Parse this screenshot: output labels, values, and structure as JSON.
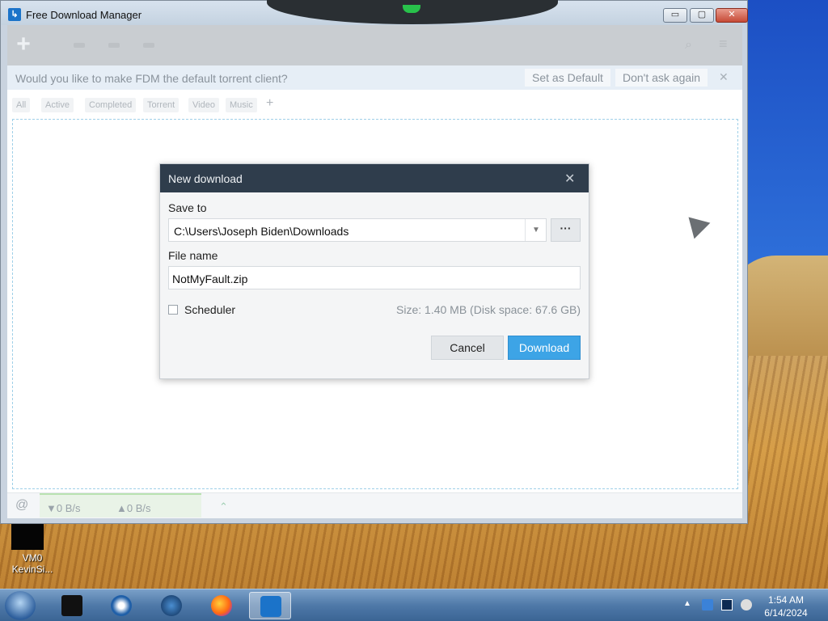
{
  "window": {
    "title": "Free Download Manager",
    "min_label": "▭",
    "max_label": "▢",
    "close_label": "✕"
  },
  "toolbar": {
    "add_label": "+"
  },
  "notice": {
    "text": "Would you like to make FDM the default torrent client?",
    "set_default": "Set as Default",
    "dont_ask": "Don't ask again",
    "close": "✕"
  },
  "tabs": [
    "All",
    "Active",
    "Completed",
    "Torrent",
    "Video",
    "Music"
  ],
  "tab_add": "+",
  "status": {
    "down": "▼0 B/s",
    "up": "▲0 B/s"
  },
  "dialog": {
    "title": "New download",
    "close": "✕",
    "save_to_label": "Save to",
    "save_to_value": "C:\\Users\\Joseph Biden\\Downloads",
    "browse_label": "···",
    "file_name_label": "File name",
    "file_name_value": "NotMyFault.zip",
    "scheduler_label": "Scheduler",
    "size_info": "Size: 1.40 MB (Disk space: 67.6 GB)",
    "cancel": "Cancel",
    "download": "Download"
  },
  "desktop": {
    "icon_label_1": "VM0",
    "icon_label_2": "KevinSi..."
  },
  "clock": {
    "time": "1:54 AM",
    "date": "6/14/2024"
  },
  "colors": {
    "accent": "#3da4e6",
    "dialog_header": "#2f3d4c"
  }
}
